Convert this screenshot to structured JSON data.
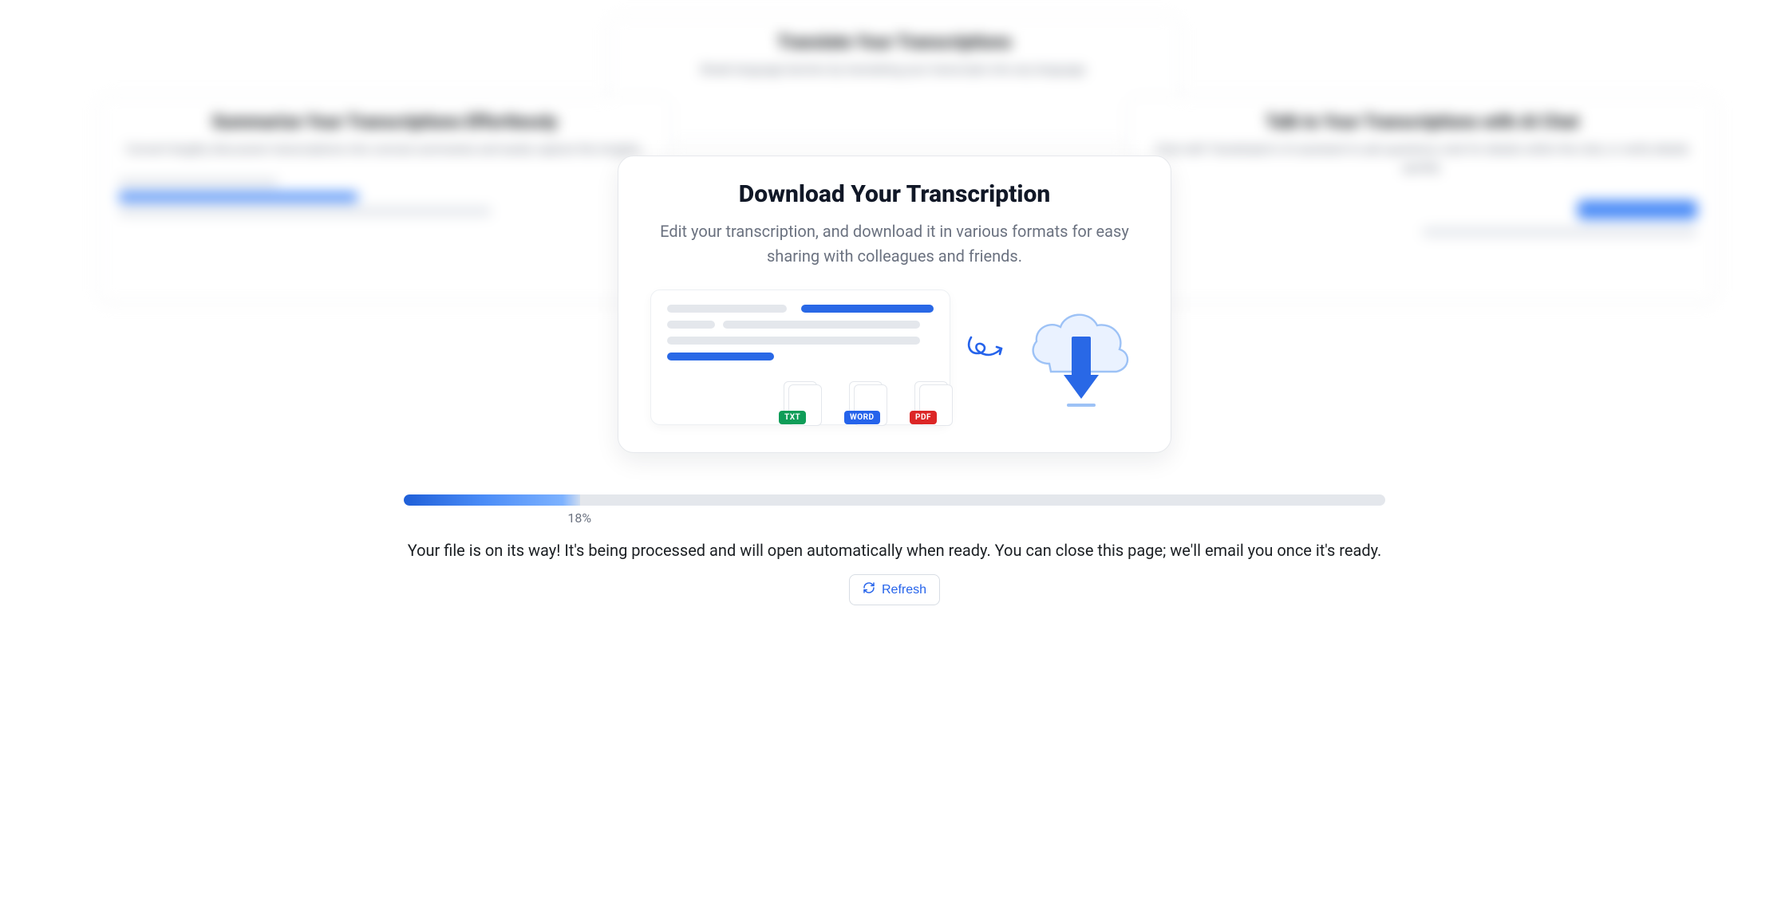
{
  "bg": {
    "left": {
      "title": "Summarize Your Transcriptions Effortlessly",
      "desc": "Convert lengthy discussion transcriptions into concise summaries and easily capture the insights."
    },
    "top": {
      "title": "Translate Your Transcriptions",
      "desc": "Break language barriers by translating your transcripts into any language."
    },
    "right": {
      "title": "Talk to Your Transcriptions with AI Chat",
      "desc": "Chat with Transkriptor's AI assistant to ask questions, look for details within the chat, or verify details quickly."
    }
  },
  "card": {
    "title": "Download Your Transcription",
    "subtitle": "Edit your transcription, and download it in various formats for easy sharing with colleagues and friends.",
    "formats": {
      "txt": "TXT",
      "word": "WORD",
      "pdf": "PDF"
    }
  },
  "progress": {
    "percent": 18,
    "label": "18%"
  },
  "status_text": "Your file is on its way! It's being processed and will open automatically when ready. You can close this page; we'll email you once it's ready.",
  "refresh_label": "Refresh"
}
